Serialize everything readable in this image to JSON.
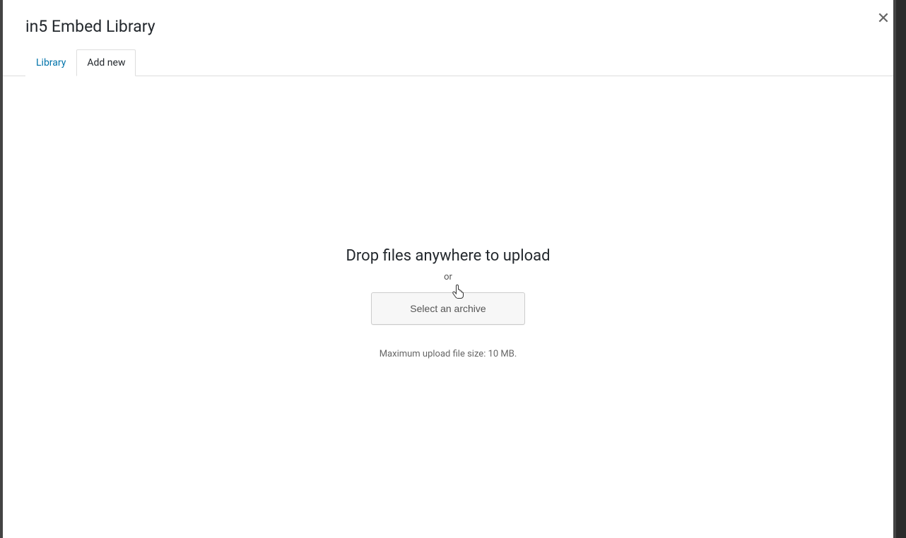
{
  "header": {
    "title": "in5 Embed Library"
  },
  "tabs": {
    "library": "Library",
    "add_new": "Add new"
  },
  "upload": {
    "drop_heading": "Drop files anywhere to upload",
    "or_text": "or",
    "select_button": "Select an archive",
    "max_size": "Maximum upload file size: 10 MB."
  },
  "icons": {
    "close": "✕"
  }
}
